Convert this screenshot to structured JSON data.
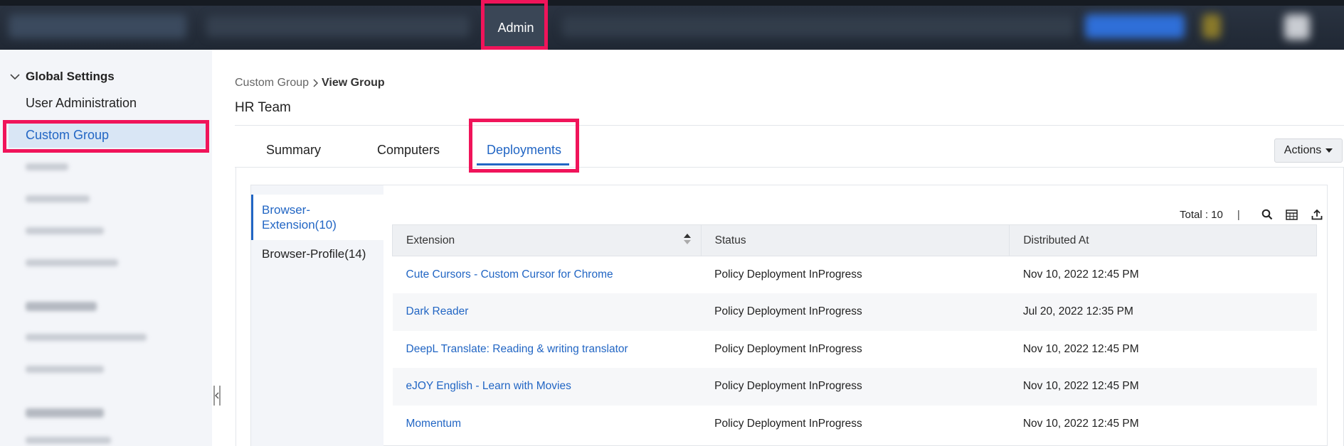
{
  "topbar": {
    "admin_label": "Admin"
  },
  "sidebar": {
    "heading": "Global Settings",
    "items": [
      {
        "label": "User Administration"
      },
      {
        "label": "Custom Group"
      }
    ]
  },
  "breadcrumb": {
    "parent": "Custom Group",
    "current": "View Group"
  },
  "page_title": "HR Team",
  "tabs": [
    {
      "label": "Summary"
    },
    {
      "label": "Computers"
    },
    {
      "label": "Deployments"
    }
  ],
  "actions_label": "Actions",
  "subnav": {
    "items": [
      {
        "label": "Browser-Extension(10)"
      },
      {
        "label": "Browser-Profile(14)"
      }
    ]
  },
  "toolbar": {
    "total": "Total : 10",
    "separator": "|"
  },
  "table": {
    "columns": [
      "Extension",
      "Status",
      "Distributed At"
    ],
    "rows": [
      {
        "extension": "Cute Cursors - Custom Cursor for Chrome",
        "status": "Policy Deployment InProgress",
        "distributed_at": "Nov 10, 2022 12:45 PM"
      },
      {
        "extension": "Dark Reader",
        "status": "Policy Deployment InProgress",
        "distributed_at": "Jul 20, 2022 12:35 PM"
      },
      {
        "extension": "DeepL Translate: Reading & writing translator",
        "status": "Policy Deployment InProgress",
        "distributed_at": "Nov 10, 2022 12:45 PM"
      },
      {
        "extension": "eJOY English - Learn with Movies",
        "status": "Policy Deployment InProgress",
        "distributed_at": "Nov 10, 2022 12:45 PM"
      },
      {
        "extension": "Momentum",
        "status": "Policy Deployment InProgress",
        "distributed_at": "Nov 10, 2022 12:45 PM"
      }
    ]
  },
  "colors": {
    "accent": "#2266c4",
    "highlight": "#f0145a",
    "topbar": "#202834"
  },
  "icons": [
    "chevron-down-icon",
    "chevron-right-icon",
    "search-icon",
    "column-chooser-icon",
    "export-icon",
    "sort-icon",
    "collapse-handle-icon"
  ]
}
